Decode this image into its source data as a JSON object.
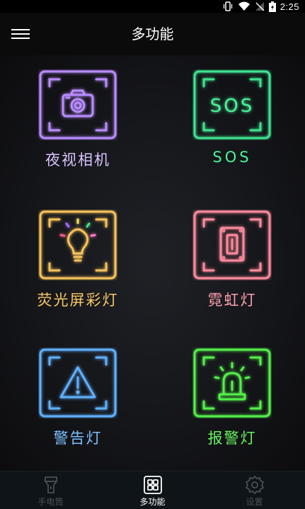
{
  "status_bar": {
    "time": "2:25",
    "icons": [
      "vibrate-icon",
      "wifi-icon",
      "no-signal-icon",
      "battery-charging-icon"
    ]
  },
  "app_bar": {
    "title": "多功能",
    "menu_icon": "menu-icon"
  },
  "tiles": [
    {
      "label": "夜视相机",
      "icon": "camera-icon",
      "color": "#b98cff"
    },
    {
      "label": "SOS",
      "icon": "sos-icon",
      "color": "#3de38f",
      "icon_text": "SOS"
    },
    {
      "label": "荧光屏彩灯",
      "icon": "lightbulb-icon",
      "color": "#f5c15a"
    },
    {
      "label": "霓虹灯",
      "icon": "switch-icon",
      "color": "#ff8a9c"
    },
    {
      "label": "警告灯",
      "icon": "warning-icon",
      "color": "#5fb0ff"
    },
    {
      "label": "报警灯",
      "icon": "alarm-beacon-icon",
      "color": "#52f04a"
    }
  ],
  "nav": {
    "items": [
      {
        "label": "手电筒",
        "icon": "flashlight-icon",
        "active": false
      },
      {
        "label": "多功能",
        "icon": "grid-icon",
        "active": true
      },
      {
        "label": "设置",
        "icon": "gear-icon",
        "active": false
      }
    ],
    "active_color": "#ffffff",
    "inactive_color": "#4a5056"
  }
}
